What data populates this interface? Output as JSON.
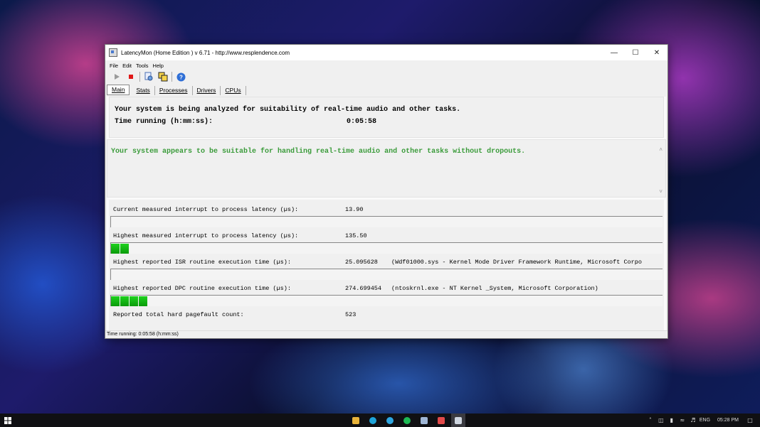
{
  "window": {
    "title": "LatencyMon  (Home Edition )  v 6.71 - http://www.resplendence.com"
  },
  "menu": [
    "File",
    "Edit",
    "Tools",
    "Help"
  ],
  "toolbar": {
    "icons": [
      "play-icon",
      "stop-icon",
      "report-icon",
      "copy-icon",
      "help-icon"
    ]
  },
  "tabs": [
    "Main",
    "Stats",
    "Processes",
    "Drivers",
    "CPUs"
  ],
  "main": {
    "analyzing_text": "Your system is being analyzed for suitability of real-time audio and other tasks.",
    "time_running_label": "Time running (h:mm:ss):",
    "time_running_value": "0:05:58",
    "verdict": "Your system appears to be suitable for handling real-time audio and other tasks without dropouts.",
    "verdict_color": "#3a9b3a",
    "metrics": [
      {
        "label": "Current measured interrupt to process latency (µs):",
        "value": "13.90",
        "extra": "",
        "bar_segments": 0
      },
      {
        "label": "Highest measured interrupt to process latency (µs):",
        "value": "135.50",
        "extra": "",
        "bar_segments": 2
      },
      {
        "label": "Highest reported ISR routine execution time (µs):",
        "value": "25.095628",
        "extra": "(Wdf01000.sys - Kernel Mode Driver Framework Runtime, Microsoft Corpo",
        "bar_segments": 0
      },
      {
        "label": "Highest reported DPC routine execution time (µs):",
        "value": "274.699454",
        "extra": "(ntoskrnl.exe - NT Kernel _System, Microsoft Corporation)",
        "bar_segments": 4
      },
      {
        "label": "Reported total hard pagefault count:",
        "value": "523",
        "extra": "",
        "bar_segments": null
      }
    ]
  },
  "statusbar": {
    "text": "Time running: 0:05:58  (h:mm:ss)"
  },
  "taskbar": {
    "tray_language": "ENG",
    "tray_time": "05:28 PM"
  }
}
